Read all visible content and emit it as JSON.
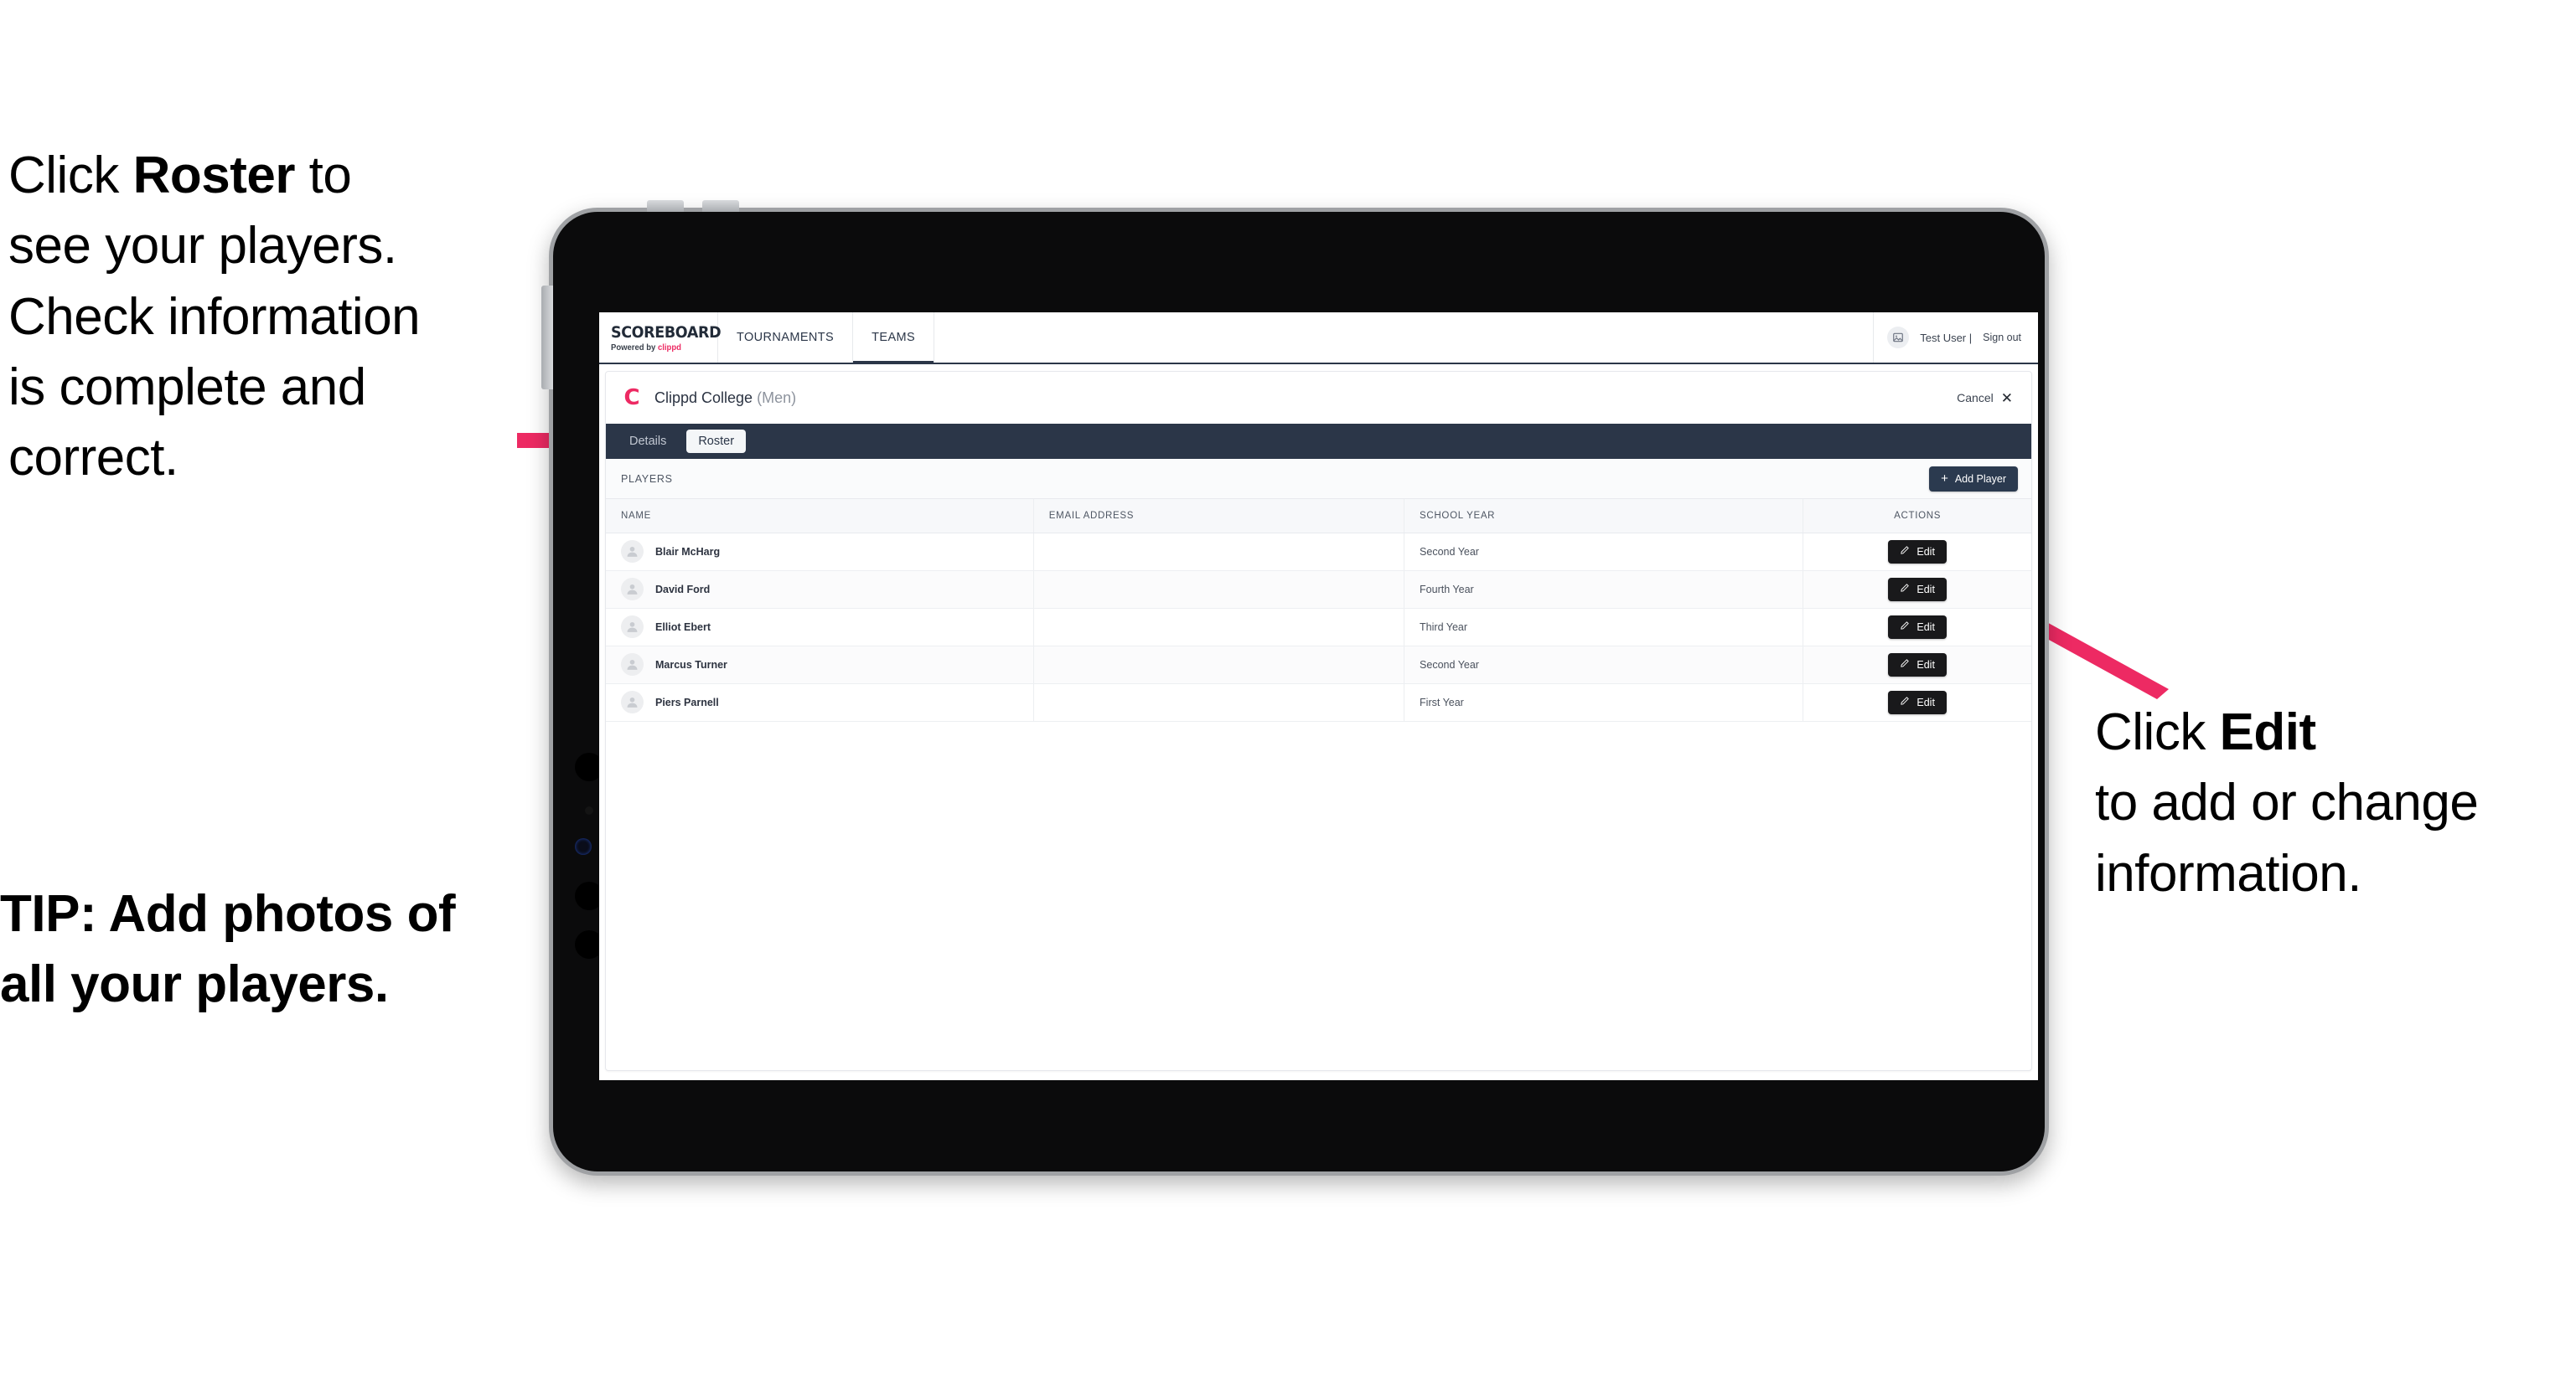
{
  "annotations": {
    "left_top": {
      "pre": "Click ",
      "strong": "Roster",
      "post": " to\nsee your players.\nCheck information\nis complete and\ncorrect."
    },
    "left_tip": "TIP: Add photos of\nall your players.",
    "right": {
      "pre": "Click ",
      "strong": "Edit",
      "post": "\nto add or change\ninformation."
    },
    "arrow_color": "#ed2a63"
  },
  "app": {
    "brand": {
      "title": "SCOREBOARD",
      "powered_prefix": "Powered by ",
      "powered_name": "clippd"
    },
    "topnav": [
      {
        "label": "TOURNAMENTS",
        "active": false
      },
      {
        "label": "TEAMS",
        "active": true
      }
    ],
    "account": {
      "avatar_icon": "user-image-icon",
      "user_label": "Test User |",
      "sign_out_label": "Sign out"
    },
    "card_header": {
      "logo_letter": "C",
      "team_name": "Clippd College ",
      "team_gender": "(Men)",
      "cancel_label": "Cancel",
      "cancel_icon": "close-icon"
    },
    "subtabs": [
      {
        "label": "Details",
        "active": false
      },
      {
        "label": "Roster",
        "active": true
      }
    ],
    "players_panel": {
      "section_label": "PLAYERS",
      "add_player_label": "Add Player",
      "add_player_icon": "plus-icon"
    },
    "table": {
      "columns": [
        "NAME",
        "EMAIL ADDRESS",
        "SCHOOL YEAR",
        "ACTIONS"
      ],
      "action_label": "Edit",
      "action_icon": "pencil-icon",
      "rows": [
        {
          "name": "Blair McHarg",
          "email": "",
          "school_year": "Second Year"
        },
        {
          "name": "David Ford",
          "email": "",
          "school_year": "Fourth Year"
        },
        {
          "name": "Elliot Ebert",
          "email": "",
          "school_year": "Third Year"
        },
        {
          "name": "Marcus Turner",
          "email": "",
          "school_year": "Second Year"
        },
        {
          "name": "Piers Parnell",
          "email": "",
          "school_year": "First Year"
        }
      ]
    }
  },
  "colors": {
    "accent_pink": "#ed2a63",
    "navy": "#2b3648",
    "button_navy": "#2b3a4f",
    "edit_black": "#19191b"
  }
}
